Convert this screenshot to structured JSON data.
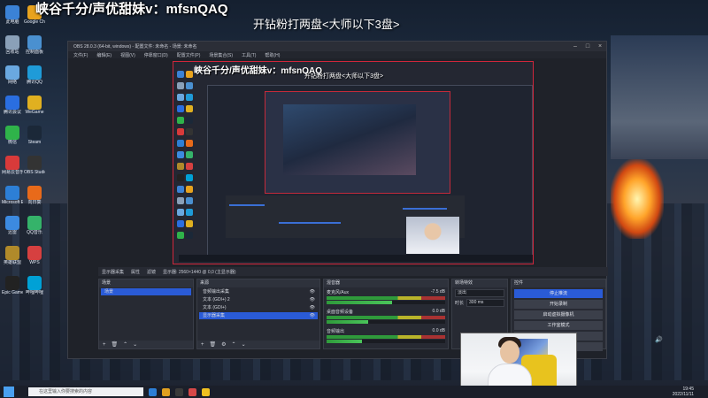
{
  "overlay": {
    "title": "峡谷千分/声优甜妹v：mfsnQAQ",
    "subtitle": "开钻粉打两盘<大师以下3盘>"
  },
  "obs": {
    "window_title": "OBS 28.0.3 (64-bit, windows) - 配置文件: 未命名 - 场景: 未命名",
    "menu": [
      "文件(F)",
      "编辑(E)",
      "视图(V)",
      "停靠窗口(D)",
      "配置文件(P)",
      "场景集合(S)",
      "工具(T)",
      "帮助(H)"
    ],
    "status_strip": {
      "source": "显示器采集",
      "properties": "属性",
      "filters": "滤镜",
      "display": "显示器: 2560×1440 @ 0,0 (主显示器)"
    },
    "scenes": {
      "header": "场景",
      "items": [
        "场景"
      ]
    },
    "sources": {
      "header": "来源",
      "items": [
        {
          "name": "音频输出采集",
          "selected": false
        },
        {
          "name": "文本 (GDI+) 2",
          "selected": false
        },
        {
          "name": "文本 (GDI+)",
          "selected": false
        },
        {
          "name": "显示器采集",
          "selected": true
        }
      ]
    },
    "mixer": {
      "header": "混音器",
      "channels": [
        {
          "name": "麦克风/Aux",
          "db": "-7.5 dB",
          "level": 0.55
        },
        {
          "name": "桌面音频设备",
          "db": "0.0 dB",
          "level": 0.35
        },
        {
          "name": "音频输出",
          "db": "0.0 dB",
          "level": 0.3
        }
      ]
    },
    "transitions": {
      "header": "转场特效",
      "type": "淡出",
      "duration_label": "时长",
      "duration": "300 ms"
    },
    "controls": {
      "header": "控件",
      "buttons": [
        "停止推流",
        "开始录制",
        "启动虚拟摄像机",
        "工作室模式",
        "设置",
        "退出"
      ]
    }
  },
  "desktop_icon_labels": [
    "此电脑",
    "Google Chrome",
    "回收站",
    "控制面板",
    "网络",
    "腾讯QQ",
    "腾讯会议",
    "WeGame",
    "微信",
    "Steam",
    "网易云音乐",
    "OBS Studio",
    "Microsoft Edge",
    "向日葵",
    "迅雷",
    "QQ音乐",
    "英雄联盟",
    "WPS",
    "Epic Games",
    "哔哩哔哩"
  ],
  "taskbar": {
    "search_placeholder": "在这里输入你要搜索的内容",
    "time": "19:45",
    "date": "2022/11/11"
  },
  "colors": {
    "obs_bg": "#1f2229",
    "obs_accent": "#2a5bd7",
    "preview_border": "#d0263b"
  }
}
